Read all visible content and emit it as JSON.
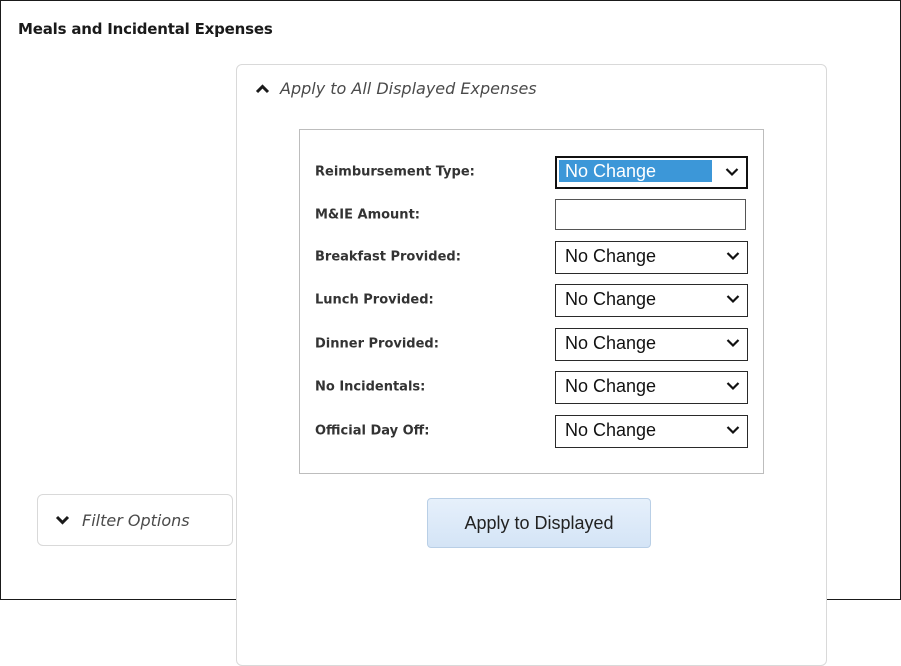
{
  "section": {
    "title": "Meals and Incidental Expenses"
  },
  "apply_panel": {
    "header": "Apply to All Displayed Expenses",
    "expanded_icon": "chevron-up-icon",
    "fields": {
      "reimbursement_type": {
        "label": "Reimbursement Type:",
        "value": "No Change"
      },
      "mie_amount": {
        "label": "M&IE Amount:",
        "value": ""
      },
      "breakfast": {
        "label": "Breakfast Provided:",
        "value": "No Change"
      },
      "lunch": {
        "label": "Lunch Provided:",
        "value": "No Change"
      },
      "dinner": {
        "label": "Dinner Provided:",
        "value": "No Change"
      },
      "no_incidentals": {
        "label": "No Incidentals:",
        "value": "No Change"
      },
      "official_day_off": {
        "label": "Official Day Off:",
        "value": "No Change"
      }
    },
    "apply_button_label": "Apply to Displayed"
  },
  "filter_panel": {
    "label": "Filter Options",
    "collapsed_icon": "chevron-down-icon"
  },
  "colors": {
    "selection_highlight": "#3c97d8",
    "button_bg": "#dbe8f7",
    "panel_border": "#d9d9d9"
  }
}
